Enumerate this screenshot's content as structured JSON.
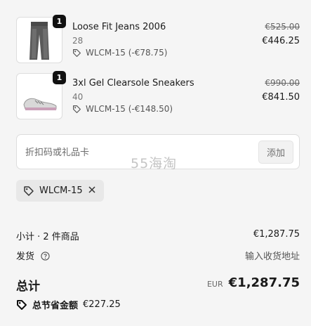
{
  "items": [
    {
      "quantity": "1",
      "name": "Loose Fit Jeans 2006",
      "variant": "28",
      "discount": "WLCM-15 (-€78.75)",
      "original_price": "€525.00",
      "price": "€446.25",
      "thumbnail_icon": "jeans-thumbnail"
    },
    {
      "quantity": "1",
      "name": "3xl Gel Clearsole Sneakers",
      "variant": "40",
      "discount": "WLCM-15 (-€148.50)",
      "original_price": "€990.00",
      "price": "€841.50",
      "thumbnail_icon": "sneakers-thumbnail"
    }
  ],
  "discount_code": {
    "placeholder": "折扣码或礼品卡",
    "value": "",
    "apply_label": "添加"
  },
  "watermark": "55海淘",
  "applied_code": {
    "label": "WLCM-15"
  },
  "summary": {
    "subtotal_label": "小计 · 2 件商品",
    "subtotal_value": "€1,287.75",
    "shipping_label": "发货",
    "shipping_value": "输入收货地址",
    "total_label": "总计",
    "total_currency": "EUR",
    "total_value": "€1,287.75",
    "savings_label": "总节省金额",
    "savings_value": "€227.25"
  }
}
